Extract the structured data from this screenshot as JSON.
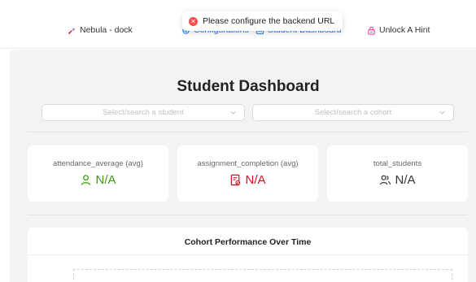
{
  "nav": {
    "brand": "Nebula - dock",
    "configurations": "Configurations",
    "student_dashboard": "Student Dashboard",
    "unlock_hint": "Unlock A Hint"
  },
  "toast": {
    "message": "Please configure the backend URL",
    "icon": "error-icon"
  },
  "page": {
    "title": "Student Dashboard"
  },
  "filters": {
    "student_placeholder": "Select/search a student",
    "cohort_placeholder": "Select/search a cohort"
  },
  "metrics": [
    {
      "label": "attendance_average (avg)",
      "value": "N/A",
      "icon": "user-icon",
      "color": "#389e0d"
    },
    {
      "label": "assignment_completion (avg)",
      "value": "N/A",
      "icon": "file-check-icon",
      "color": "#cf1322"
    },
    {
      "label": "total_students",
      "value": "N/A",
      "icon": "users-icon",
      "color": "#333333"
    }
  ],
  "chart": {
    "title": "Cohort Performance Over Time"
  },
  "colors": {
    "accent": "#1677ff",
    "error": "#ff4d4f",
    "background": "#f3f3f3"
  }
}
